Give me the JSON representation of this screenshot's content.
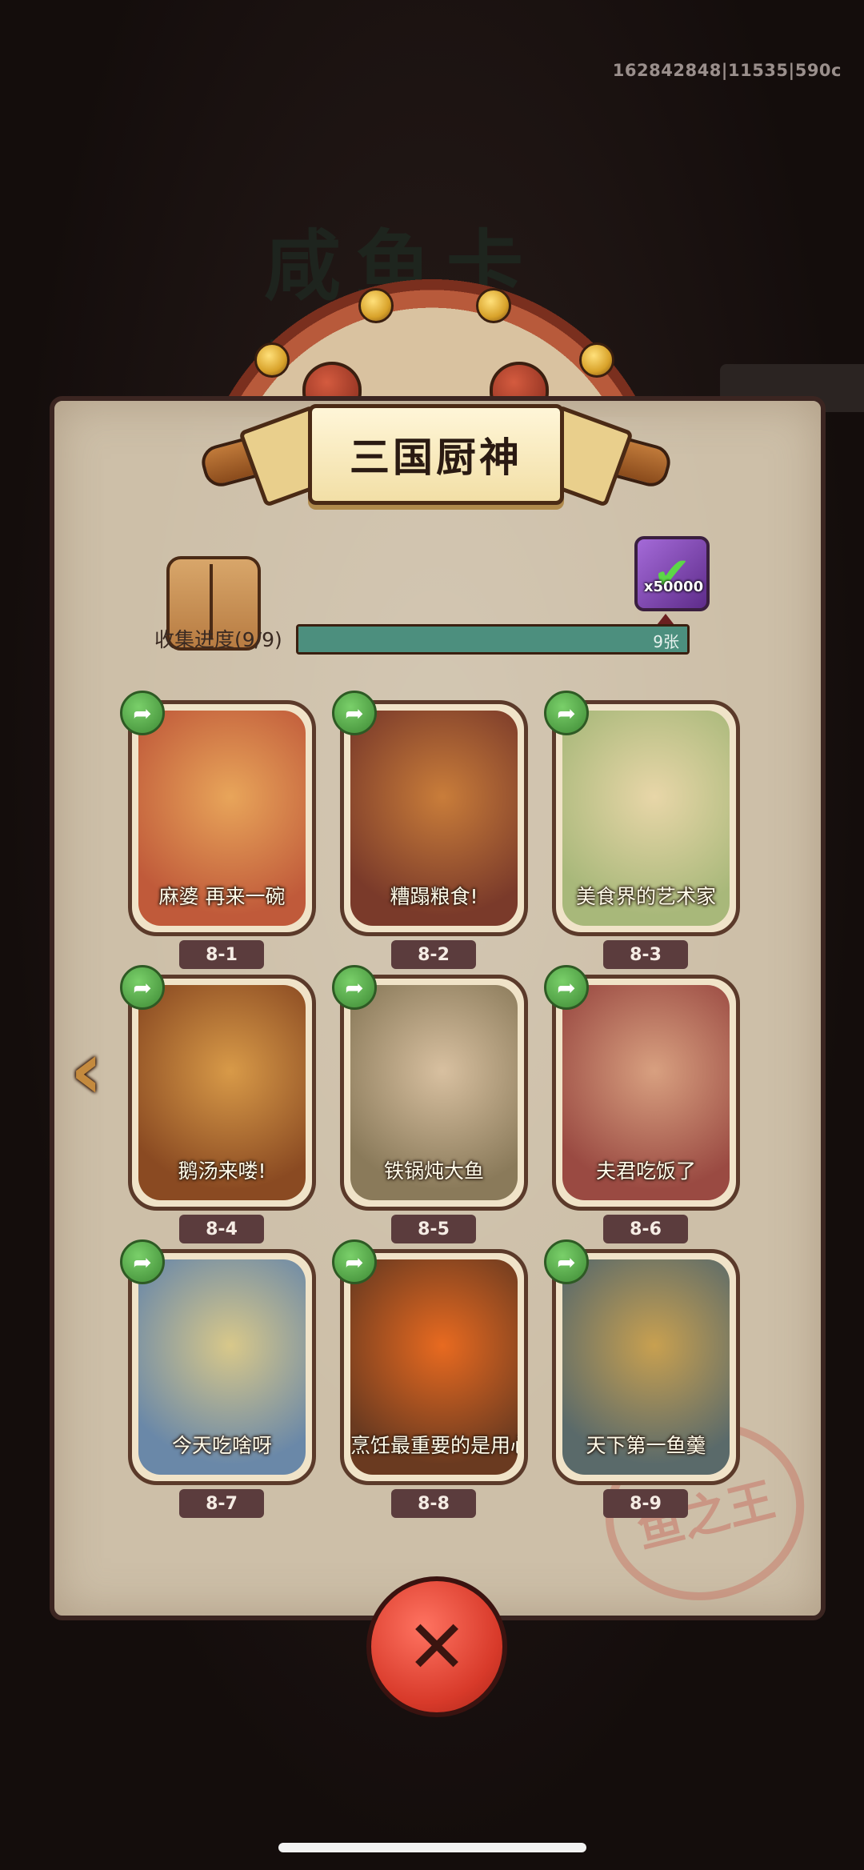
{
  "debug": "162842848|11535|590c",
  "bg_title": "咸鱼卡牌",
  "title": "三国厨神",
  "progress": {
    "label": "收集进度(9/9)",
    "count": "9张",
    "fraction": 1.0
  },
  "reward": {
    "icon": "check-gem-icon",
    "count": "x50000"
  },
  "cards": [
    {
      "name": "麻婆 再来一碗",
      "id": "8-1",
      "palette": [
        "#c05a3a",
        "#e8a55a"
      ]
    },
    {
      "name": "糟蹋粮食!",
      "id": "8-2",
      "palette": [
        "#7a3a2a",
        "#c97d3a"
      ]
    },
    {
      "name": "美食界的艺术家",
      "id": "8-3",
      "palette": [
        "#a8b87a",
        "#e8d6a8"
      ]
    },
    {
      "name": "鹅汤来喽!",
      "id": "8-4",
      "palette": [
        "#8a4a22",
        "#d89a48"
      ]
    },
    {
      "name": "铁锅炖大鱼",
      "id": "8-5",
      "palette": [
        "#8a7a5a",
        "#d8c0a0"
      ]
    },
    {
      "name": "夫君吃饭了",
      "id": "8-6",
      "palette": [
        "#9a4a42",
        "#d8a080"
      ]
    },
    {
      "name": "今天吃啥呀",
      "id": "8-7",
      "palette": [
        "#6a88a8",
        "#d8c88a"
      ]
    },
    {
      "name": "烹饪最重要的是用心",
      "id": "8-8",
      "palette": [
        "#6a3a20",
        "#e86a20"
      ]
    },
    {
      "name": "天下第一鱼羹",
      "id": "8-9",
      "palette": [
        "#5a6a6a",
        "#c8a050"
      ]
    }
  ],
  "stamp_text": "鱼之王",
  "icons": {
    "share": "share-arrow-icon",
    "nav_left": "chevron-left-icon",
    "close": "close-x-icon"
  },
  "colors": {
    "accent_green": "#4c8f7e",
    "close_red": "#d83a2a",
    "panel": "#cdbfa8"
  }
}
